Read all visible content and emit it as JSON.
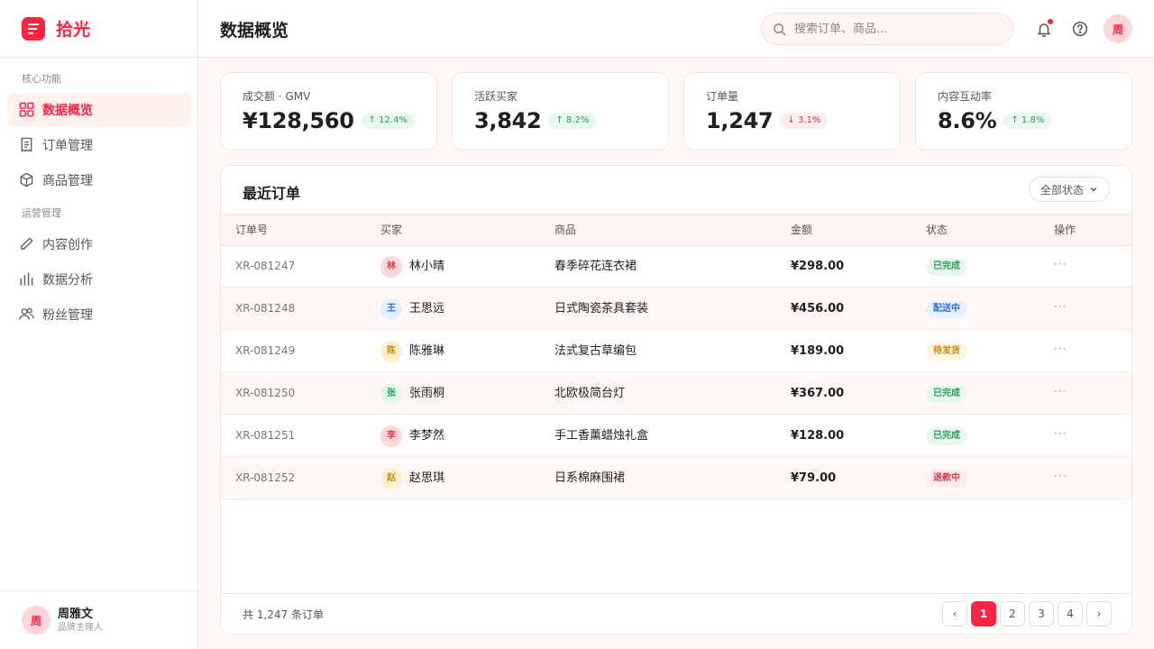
{
  "app": {
    "name": "拾光"
  },
  "sidebar": {
    "sections": [
      {
        "title": "核心功能",
        "items": [
          {
            "label": "数据概览",
            "icon": "grid-icon",
            "active": true
          },
          {
            "label": "订单管理",
            "icon": "receipt-icon"
          },
          {
            "label": "商品管理",
            "icon": "box-icon"
          }
        ]
      },
      {
        "title": "运营管理",
        "items": [
          {
            "label": "内容创作",
            "icon": "pencil-icon"
          },
          {
            "label": "数据分析",
            "icon": "bar-chart-icon"
          },
          {
            "label": "粉丝管理",
            "icon": "users-icon"
          }
        ]
      }
    ],
    "user": {
      "avatar": "周",
      "name": "周雅文",
      "role": "品牌主理人"
    }
  },
  "header": {
    "title": "数据概览",
    "search_placeholder": "搜索订单、商品...",
    "avatar": "周"
  },
  "stats": [
    {
      "label": "成交额 · GMV",
      "value": "¥128,560",
      "trend": "↑ 12.4%",
      "direction": "up"
    },
    {
      "label": "活跃买家",
      "value": "3,842",
      "trend": "↑ 8.2%",
      "direction": "up"
    },
    {
      "label": "订单量",
      "value": "1,247",
      "trend": "↓ 3.1%",
      "direction": "down"
    },
    {
      "label": "内容互动率",
      "value": "8.6%",
      "trend": "↑ 1.8%",
      "direction": "up"
    }
  ],
  "orders": {
    "title": "最近订单",
    "filter_label": "全部状态",
    "columns": [
      "订单号",
      "买家",
      "商品",
      "金额",
      "状态",
      "操作"
    ],
    "rows": [
      {
        "id": "XR-081247",
        "avatar": "林",
        "buyer": "林小晴",
        "product": "春季碎花连衣裙",
        "amount": "¥298.00",
        "status": "已完成",
        "status_type": "done"
      },
      {
        "id": "XR-081248",
        "avatar": "王",
        "buyer": "王思远",
        "product": "日式陶瓷茶具套装",
        "amount": "¥456.00",
        "status": "配送中",
        "status_type": "shipping"
      },
      {
        "id": "XR-081249",
        "avatar": "陈",
        "buyer": "陈雅琳",
        "product": "法式复古草编包",
        "amount": "¥189.00",
        "status": "待发货",
        "status_type": "pending"
      },
      {
        "id": "XR-081250",
        "avatar": "张",
        "buyer": "张雨桐",
        "product": "北欧极简台灯",
        "amount": "¥367.00",
        "status": "已完成",
        "status_type": "done"
      },
      {
        "id": "XR-081251",
        "avatar": "李",
        "buyer": "李梦然",
        "product": "手工香薰蜡烛礼盒",
        "amount": "¥128.00",
        "status": "已完成",
        "status_type": "done"
      },
      {
        "id": "XR-081252",
        "avatar": "赵",
        "buyer": "赵思琪",
        "product": "日系棉麻围裙",
        "amount": "¥79.00",
        "status": "退款中",
        "status_type": "refund"
      }
    ],
    "action_label": "···",
    "total_text": "共 1,247 条订单",
    "pages": [
      "1",
      "2",
      "3",
      "4"
    ],
    "current_page": "1",
    "prev_label": "‹",
    "next_label": "›"
  },
  "colors": {
    "accent": "#ff2442",
    "status": {
      "done": {
        "bg": "#e9f8ef",
        "fg": "#2e9b5a"
      },
      "shipping": {
        "bg": "#e8f1ff",
        "fg": "#2f6fd8"
      },
      "pending": {
        "bg": "#fff6df",
        "fg": "#c98a12"
      },
      "refund": {
        "bg": "#ffecee",
        "fg": "#e0354a"
      }
    },
    "avatar": {
      "林": {
        "bg": "#ffd6dc",
        "fg": "#e0354a"
      },
      "王": {
        "bg": "#e3eeff",
        "fg": "#2f6fd8"
      },
      "陈": {
        "bg": "#fff0cc",
        "fg": "#c98a12"
      },
      "张": {
        "bg": "#e4f7ea",
        "fg": "#2e9b5a"
      },
      "李": {
        "bg": "#ffd6dc",
        "fg": "#e0354a"
      },
      "赵": {
        "bg": "#fff0cc",
        "fg": "#c98a12"
      }
    }
  }
}
